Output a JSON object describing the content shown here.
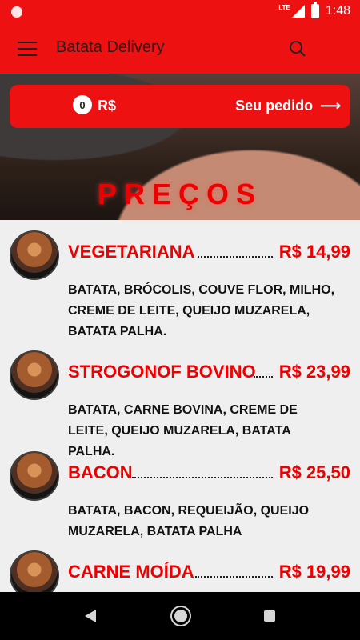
{
  "status": {
    "network": "LTE",
    "time": "1:48"
  },
  "app": {
    "title": "Batata Delivery"
  },
  "order": {
    "count": "0",
    "currency": "R$",
    "link_label": "Seu pedido",
    "arrow": "⟶"
  },
  "hero": {
    "title": "PREÇOS"
  },
  "items": [
    {
      "name": "VEGETARIANA",
      "price": "R$ 14,99",
      "description": "BATATA, BRÓCOLIS, COUVE FLOR, MILHO, CREME DE LEITE, QUEIJO MUZARELA, BATATA PALHA."
    },
    {
      "name": "STROGONOF BOVINO",
      "price": "R$ 23,99",
      "description": "BATATA, CARNE BOVINA, CREME DE LEITE, QUEIJO MUZARELA, BATATA PALHA."
    },
    {
      "name": "BACON",
      "price": "R$ 25,50",
      "description": "BATATA, BACON, REQUEIJÃO, QUEIJO MUZARELA, BATATA PALHA"
    },
    {
      "name": "CARNE MOÍDA",
      "price": "R$ 19,99",
      "description": ""
    }
  ],
  "icons": {
    "menu": "menu-icon",
    "search": "search-icon",
    "back": "back-icon",
    "home": "home-icon",
    "recent": "recent-apps-icon"
  },
  "colors": {
    "accent": "#ee1111",
    "price_red": "#ee0000",
    "background": "#efefef"
  }
}
